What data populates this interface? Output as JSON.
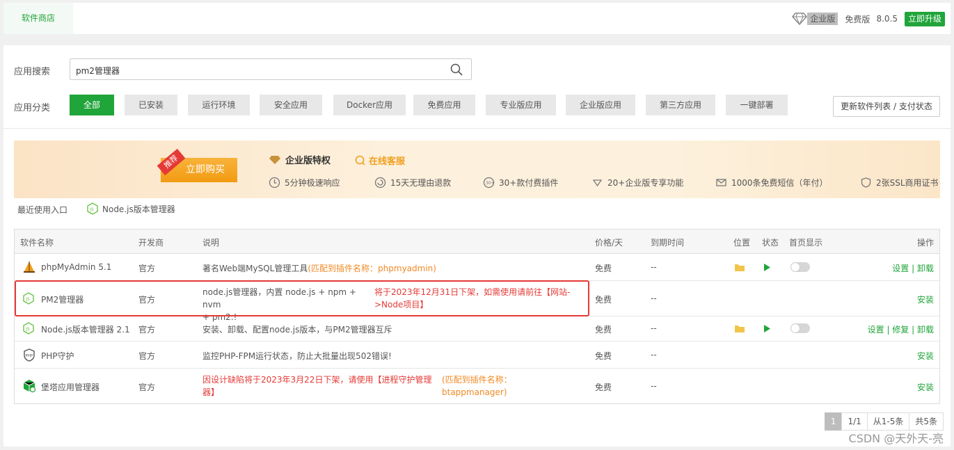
{
  "topbar": {
    "tab": "软件商店",
    "enterprise_badge": "企业版",
    "edition": "免费版",
    "version": "8.0.5",
    "upgrade": "立即升级"
  },
  "search": {
    "label": "应用搜索",
    "value": "pm2管理器"
  },
  "categories": {
    "label": "应用分类",
    "items": [
      "全部",
      "已安装",
      "运行环境",
      "安全应用",
      "Docker应用",
      "免费应用",
      "专业版应用",
      "企业版应用",
      "第三方应用",
      "一键部署"
    ],
    "refresh": "更新软件列表 / 支付状态"
  },
  "banner": {
    "tag": "推荐",
    "buy": "立即购买",
    "title": "企业版特权",
    "service": "在线客服",
    "features": [
      "5分钟极速响应",
      "15天无理由退款",
      "30+款付费插件",
      "20+企业版专享功能",
      "1000条免费短信（年付）",
      "2张SSL商用证书"
    ]
  },
  "recent": {
    "label": "最近使用入口",
    "item": "Node.js版本管理器"
  },
  "table": {
    "headers": [
      "软件名称",
      "开发商",
      "说明",
      "价格/天",
      "到期时间",
      "位置",
      "状态",
      "首页显示",
      "操作"
    ],
    "rows": [
      {
        "name": "phpMyAdmin 5.1",
        "vendor": "官方",
        "desc": "著名Web端MySQL管理工具",
        "match": "(匹配到插件名称：phpmyadmin)",
        "price": "免费",
        "expire": "--",
        "ops": [
          "设置",
          "卸载"
        ]
      },
      {
        "name": "PM2管理器",
        "vendor": "官方",
        "desc_line1": "node.js管理器，内置 node.js + npm + nvm",
        "desc_line2": "+ pm2.!",
        "notice_line1": "将于2023年12月31日下架，如需使用请前往【网站-",
        "notice_line2": ">Node项目】",
        "price": "免费",
        "expire": "--",
        "ops": [
          "安装"
        ]
      },
      {
        "name": "Node.js版本管理器 2.1",
        "vendor": "官方",
        "desc": "安装、卸载、配置node.js版本，与PM2管理器互斥",
        "price": "免费",
        "expire": "--",
        "ops": [
          "设置",
          "修复",
          "卸载"
        ]
      },
      {
        "name": "PHP守护",
        "vendor": "官方",
        "desc": "监控PHP-FPM运行状态，防止大批量出现502错误!",
        "price": "免费",
        "expire": "--",
        "ops": [
          "安装"
        ]
      },
      {
        "name": "堡塔应用管理器",
        "vendor": "官方",
        "notice_line1": "因设计缺陷将于2023年3月22日下架，请使用【进程守护管理",
        "notice_line2": "器】",
        "match_line1": "(匹配到插件名称：",
        "match_line2": "btappmanager)",
        "price": "免费",
        "expire": "--",
        "ops": [
          "安装"
        ]
      }
    ]
  },
  "pager": {
    "current": "1",
    "pages": "1/1",
    "range": "从1-5条",
    "total": "共5条"
  },
  "watermark": "CSDN @天外天-亮",
  "colors": {
    "accent": "#20a53a",
    "warning": "#e53935",
    "match": "#f08a24"
  }
}
